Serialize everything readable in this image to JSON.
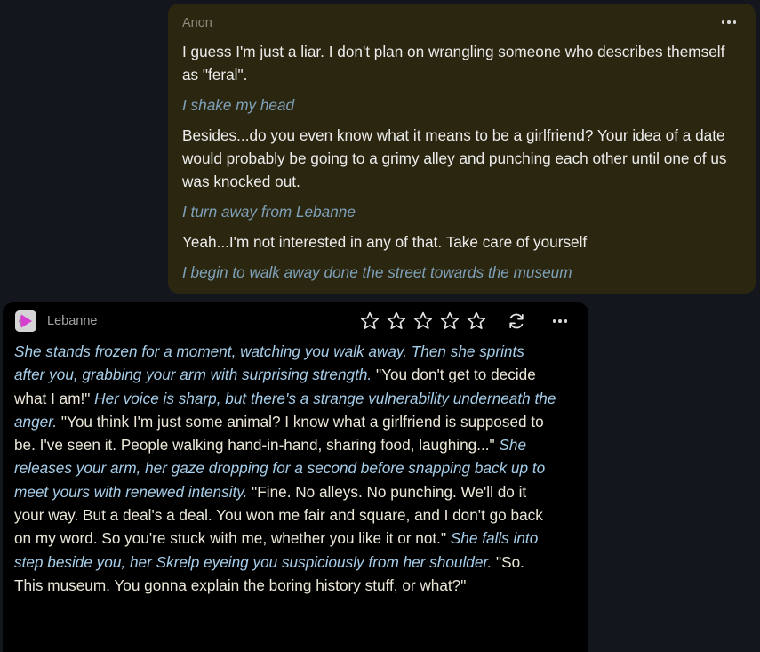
{
  "user_message": {
    "author": "Anon",
    "paragraphs": [
      {
        "type": "speech",
        "text": "I guess I'm just a liar. I don't plan on wrangling someone who describes themself as \"feral\"."
      },
      {
        "type": "action",
        "text": "I shake my head"
      },
      {
        "type": "speech",
        "text": "Besides...do you even know what it means to be a girlfriend? Your idea of a date would probably be going to a grimy alley and punching each other until one of us was knocked out."
      },
      {
        "type": "action",
        "text": "I turn away from Lebanne"
      },
      {
        "type": "speech",
        "text": "Yeah...I'm not interested in any of that. Take care of yourself"
      },
      {
        "type": "action",
        "text": "I begin to walk away done the street towards the museum"
      }
    ],
    "more_icon": "more-horizontal-icon"
  },
  "bot_message": {
    "name": "Lebanne",
    "avatar_icon": "play-triangle-avatar",
    "rating": {
      "max": 5,
      "value": 0
    },
    "star_icon": "star-outline-icon",
    "regenerate_icon": "refresh-icon",
    "more_icon": "more-horizontal-icon",
    "segments": [
      {
        "type": "action",
        "text": "She stands frozen for a moment, watching you walk away. Then she sprints after you, grabbing your arm with surprising strength."
      },
      {
        "type": "speech",
        "text": " \"You don't get to decide what I am!\" "
      },
      {
        "type": "action",
        "text": "Her voice is sharp, but there's a strange vulnerability underneath the anger."
      },
      {
        "type": "speech",
        "text": " \"You think I'm just some animal? I know what a girlfriend is supposed to be. I've seen it. People walking hand-in-hand, sharing food, laughing...\" "
      },
      {
        "type": "action",
        "text": "She releases your arm, her gaze dropping for a second before snapping back up to meet yours with renewed intensity."
      },
      {
        "type": "speech",
        "text": " \"Fine. No alleys. No punching. We'll do it your way. But a deal's a deal. You won me fair and square, and I don't go back on my word. So you're stuck with me, whether you like it or not.\" "
      },
      {
        "type": "action",
        "text": "She falls into step beside you, her Skrelp eyeing you suspiciously from her shoulder."
      },
      {
        "type": "speech",
        "text": " \"So. This museum. You gonna explain the boring history stuff, or what?\""
      }
    ]
  },
  "colors": {
    "background": "#13161d",
    "user_bubble": "#2b2610",
    "user_text": "#ececec",
    "user_action": "#7ea1b9",
    "bot_bubble": "#000000",
    "bot_text": "#ece7d8",
    "bot_action": "#a6cde9",
    "avatar_accent": "#d63ecf"
  }
}
